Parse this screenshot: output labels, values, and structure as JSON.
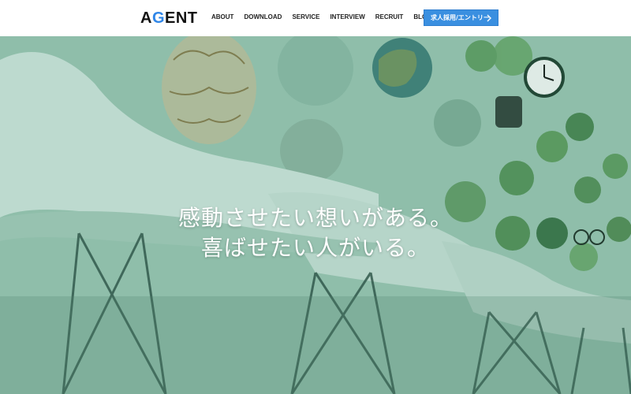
{
  "header": {
    "logo_prefix": "A",
    "logo_accent": "G",
    "logo_suffix": "ENT",
    "nav": [
      "ABOUT",
      "DOWNLOAD",
      "SERVICE",
      "INTERVIEW",
      "RECRUIT",
      "BLOG"
    ],
    "cta_label": "求人採用/エントリー",
    "cta_icon": "chevron-right-icon"
  },
  "hero": {
    "line1": "感動させたい想いがある。",
    "line2": "喜ばせたい人がいる。"
  },
  "colors": {
    "accent": "#2f86e8",
    "cta_bg": "#3a8fe0",
    "header_bg": "#ffffff",
    "hero_tint": "#8fbfae"
  }
}
